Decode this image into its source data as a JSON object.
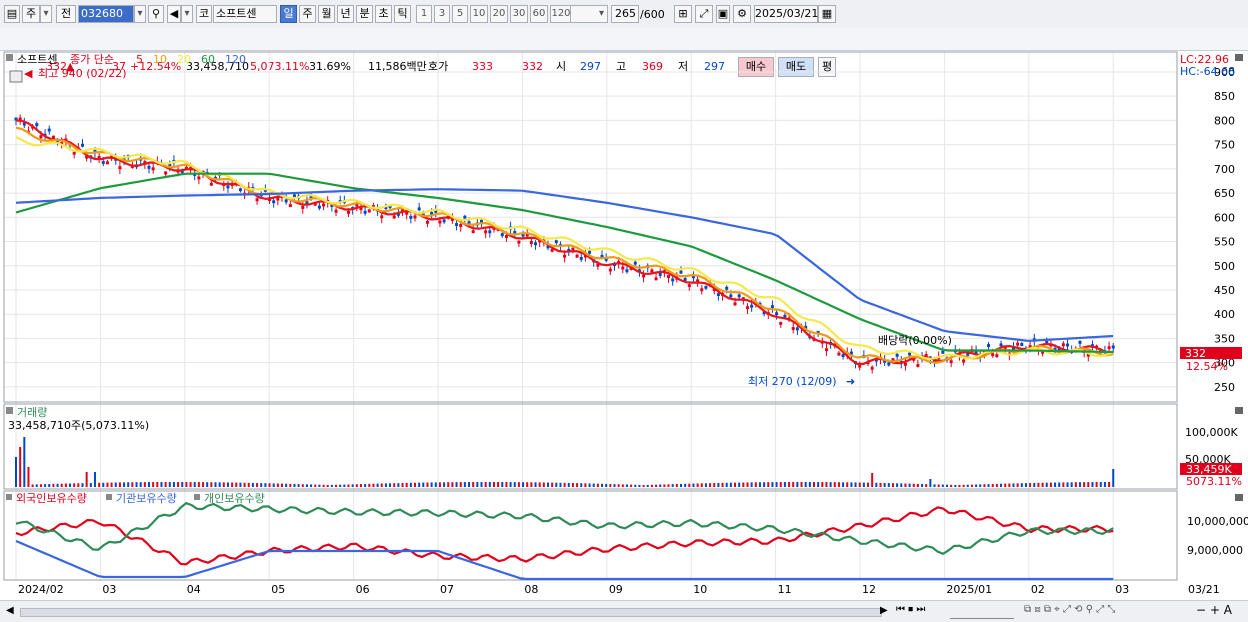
{
  "toolbar": {
    "market": "주",
    "prev_label": "전",
    "code": "032680",
    "search_icon": "search-icon",
    "sound_icon": "speaker-icon",
    "market_type": "코",
    "stock_name": "소프트센",
    "periods": [
      "일",
      "주",
      "월",
      "년",
      "분",
      "초",
      "틱"
    ],
    "active_period": "일",
    "intervals": [
      "1",
      "3",
      "5",
      "10",
      "20",
      "30",
      "60",
      "120"
    ],
    "count": "265",
    "count_max": "/600",
    "date": "2025/03/21"
  },
  "quote": {
    "price": "332",
    "change_arrow": "▲",
    "change": "37",
    "change_pct": "+12.54%",
    "volume": "33,458,710",
    "volume_ratio": "5,073.11%",
    "turnover": "31.69%",
    "amount": "11,586백만",
    "hoga_label": "호가",
    "ask": "333",
    "bid": "332",
    "open_label": "시",
    "open": "297",
    "high_label": "고",
    "high": "369",
    "low_label": "저",
    "low": "297",
    "buy_button": "매수",
    "sell_button": "매도",
    "eval_button": "평"
  },
  "price_panel": {
    "stock_label": "소프트센",
    "ma_prefix": "종가 단순",
    "ma_periods": [
      "5",
      "10",
      "20",
      "60",
      "120"
    ],
    "ma_colors": [
      "#e8141b",
      "#f09a1a",
      "#f5e84a",
      "#1e9a3e",
      "#3a66e0"
    ],
    "lc_label": "LC:22.96",
    "hc_label": "HC:-64.68",
    "high_note": "최고 940 (02/22)",
    "low_note": "최저 270 (12/09)",
    "dividend_note": "배당락(0.00%)",
    "current_price_tag": "332",
    "current_pct_tag": "12.54%",
    "y_ticks": [
      "900",
      "850",
      "800",
      "750",
      "700",
      "650",
      "600",
      "550",
      "500",
      "450",
      "400",
      "350",
      "300",
      "250"
    ]
  },
  "volume_panel": {
    "title": "거래량",
    "value_label": "33,458,710주(5,073.11%)",
    "y_ticks": [
      "100,000K",
      "50,000K"
    ],
    "current_tag": "33,459K",
    "pct_tag": "5073.11%"
  },
  "holding_panel": {
    "series": [
      "외국인보유수량",
      "기관보유수량",
      "개인보유수량"
    ],
    "series_colors": [
      "#e0001b",
      "#3a66e0",
      "#2e8b57"
    ],
    "y_ticks": [
      "10,000,000",
      "9,000,000"
    ]
  },
  "x_axis": {
    "labels": [
      "2024/02",
      "03",
      "04",
      "05",
      "06",
      "07",
      "08",
      "09",
      "10",
      "11",
      "12",
      "2025/01",
      "02",
      "03"
    ],
    "right_label": "03/21"
  },
  "chart_data": {
    "type": "line",
    "title": "",
    "x": [
      "2024/02",
      "2024/03",
      "2024/04",
      "2024/05",
      "2024/06",
      "2024/07",
      "2024/08",
      "2024/09",
      "2024/10",
      "2024/11",
      "2024/12",
      "2025/01",
      "2025/02",
      "2025/03"
    ],
    "ylim": [
      225,
      935
    ],
    "series": [
      {
        "name": "5",
        "values": [
          800,
          720,
          700,
          640,
          620,
          600,
          560,
          505,
          470,
          400,
          300,
          310,
          335,
          325
        ]
      },
      {
        "name": "10",
        "values": [
          780,
          730,
          705,
          645,
          625,
          605,
          565,
          515,
          480,
          410,
          310,
          305,
          330,
          320
        ]
      },
      {
        "name": "20",
        "values": [
          760,
          735,
          710,
          650,
          630,
          610,
          575,
          530,
          490,
          430,
          330,
          310,
          325,
          318
        ]
      },
      {
        "name": "60",
        "values": [
          610,
          660,
          690,
          690,
          660,
          640,
          615,
          580,
          540,
          470,
          390,
          325,
          325,
          322
        ]
      },
      {
        "name": "120",
        "values": [
          630,
          640,
          645,
          648,
          655,
          658,
          655,
          630,
          600,
          565,
          430,
          365,
          345,
          355
        ]
      }
    ],
    "last_close": 332,
    "extremes": {
      "high": 940,
      "low": 270
    }
  }
}
